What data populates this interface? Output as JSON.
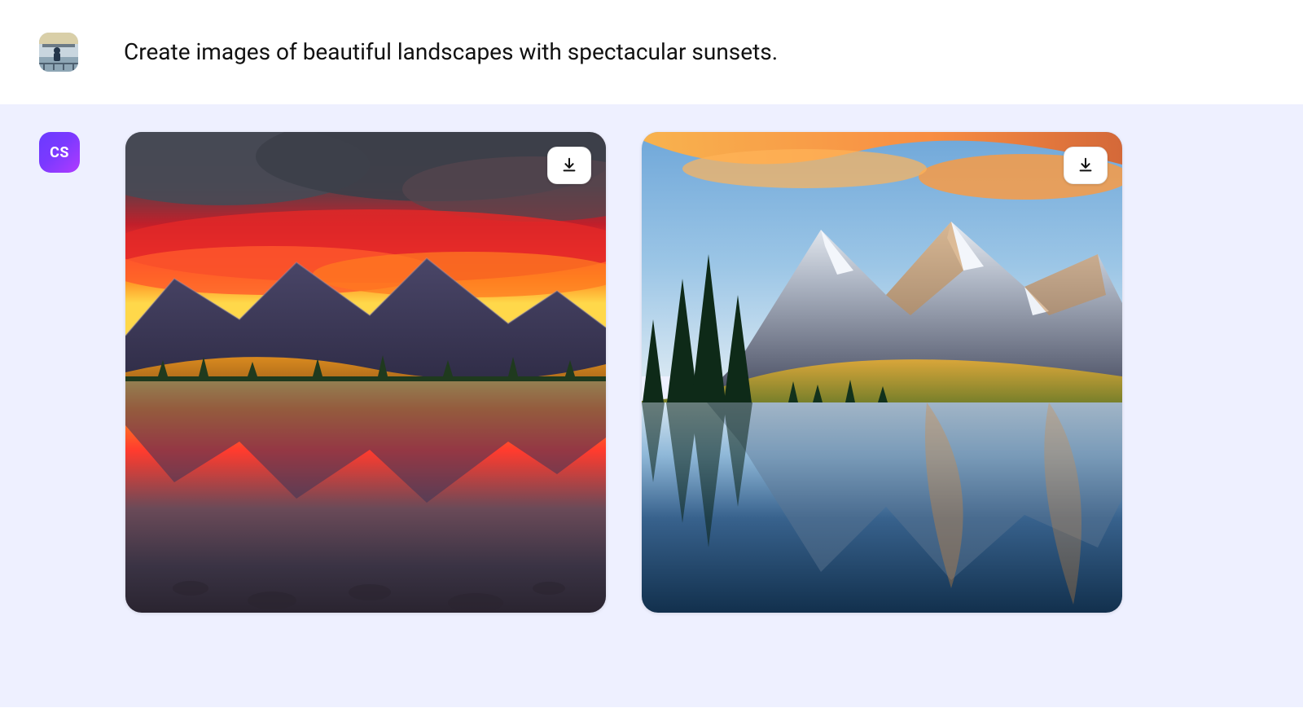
{
  "prompt": {
    "text": "Create images of beautiful landscapes with spectacular sunsets."
  },
  "assistant": {
    "badge": "CS"
  },
  "images": [
    {
      "alt": "Sunset over mountain lake with fiery red and orange clouds reflected in calm water"
    },
    {
      "alt": "Snow-capped mountains and pine trees at golden hour reflected in a still alpine lake"
    }
  ],
  "icons": {
    "download": "download-icon"
  }
}
